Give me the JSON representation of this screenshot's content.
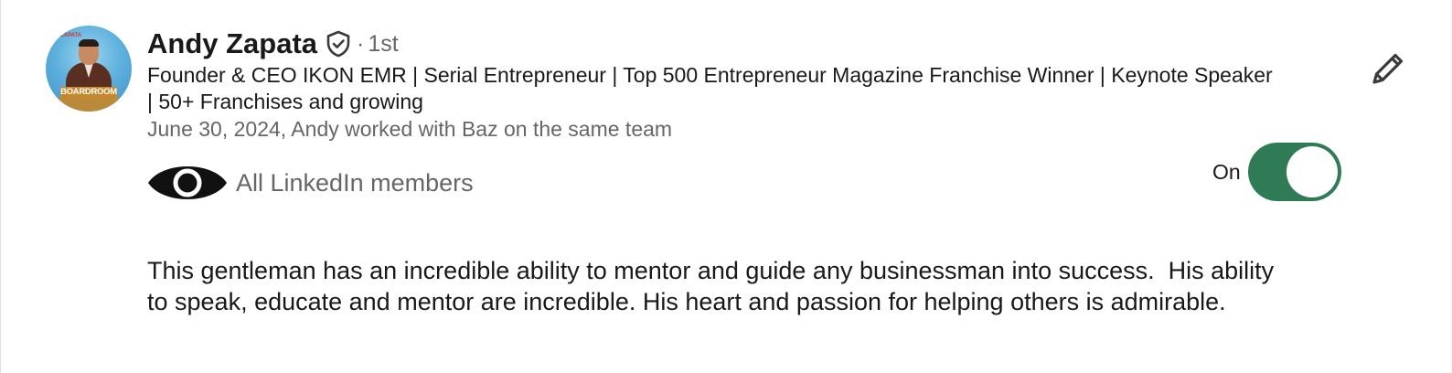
{
  "recommendation": {
    "author_name": "Andy Zapata",
    "separator": "·",
    "connection_degree": "1st",
    "headline": "Founder & CEO IKON EMR | Serial Entrepreneur | Top 500 Entrepreneur Magazine Franchise Winner | Keynote Speaker | 50+ Franchises  and growing",
    "relationship": "June 30, 2024, Andy worked with Baz on the same team",
    "visibility_label": "All LinkedIn members",
    "toggle_label": "On",
    "toggle_state": "on",
    "body": "This gentleman has an incredible ability to mentor and guide any businessman into success.  His ability to speak, educate and mentor are incredible. His heart and passion for helping others is admirable.",
    "avatar_banner_text": "BOARDROOM",
    "avatar_tag_text": "ZAPATA"
  },
  "icons": {
    "verified": "verified-shield-icon",
    "visibility": "eye-icon",
    "edit": "pencil-icon"
  },
  "colors": {
    "toggle_on": "#2f7b55",
    "text_primary": "#191919",
    "text_secondary": "#666666",
    "card_background": "#ffffff"
  }
}
